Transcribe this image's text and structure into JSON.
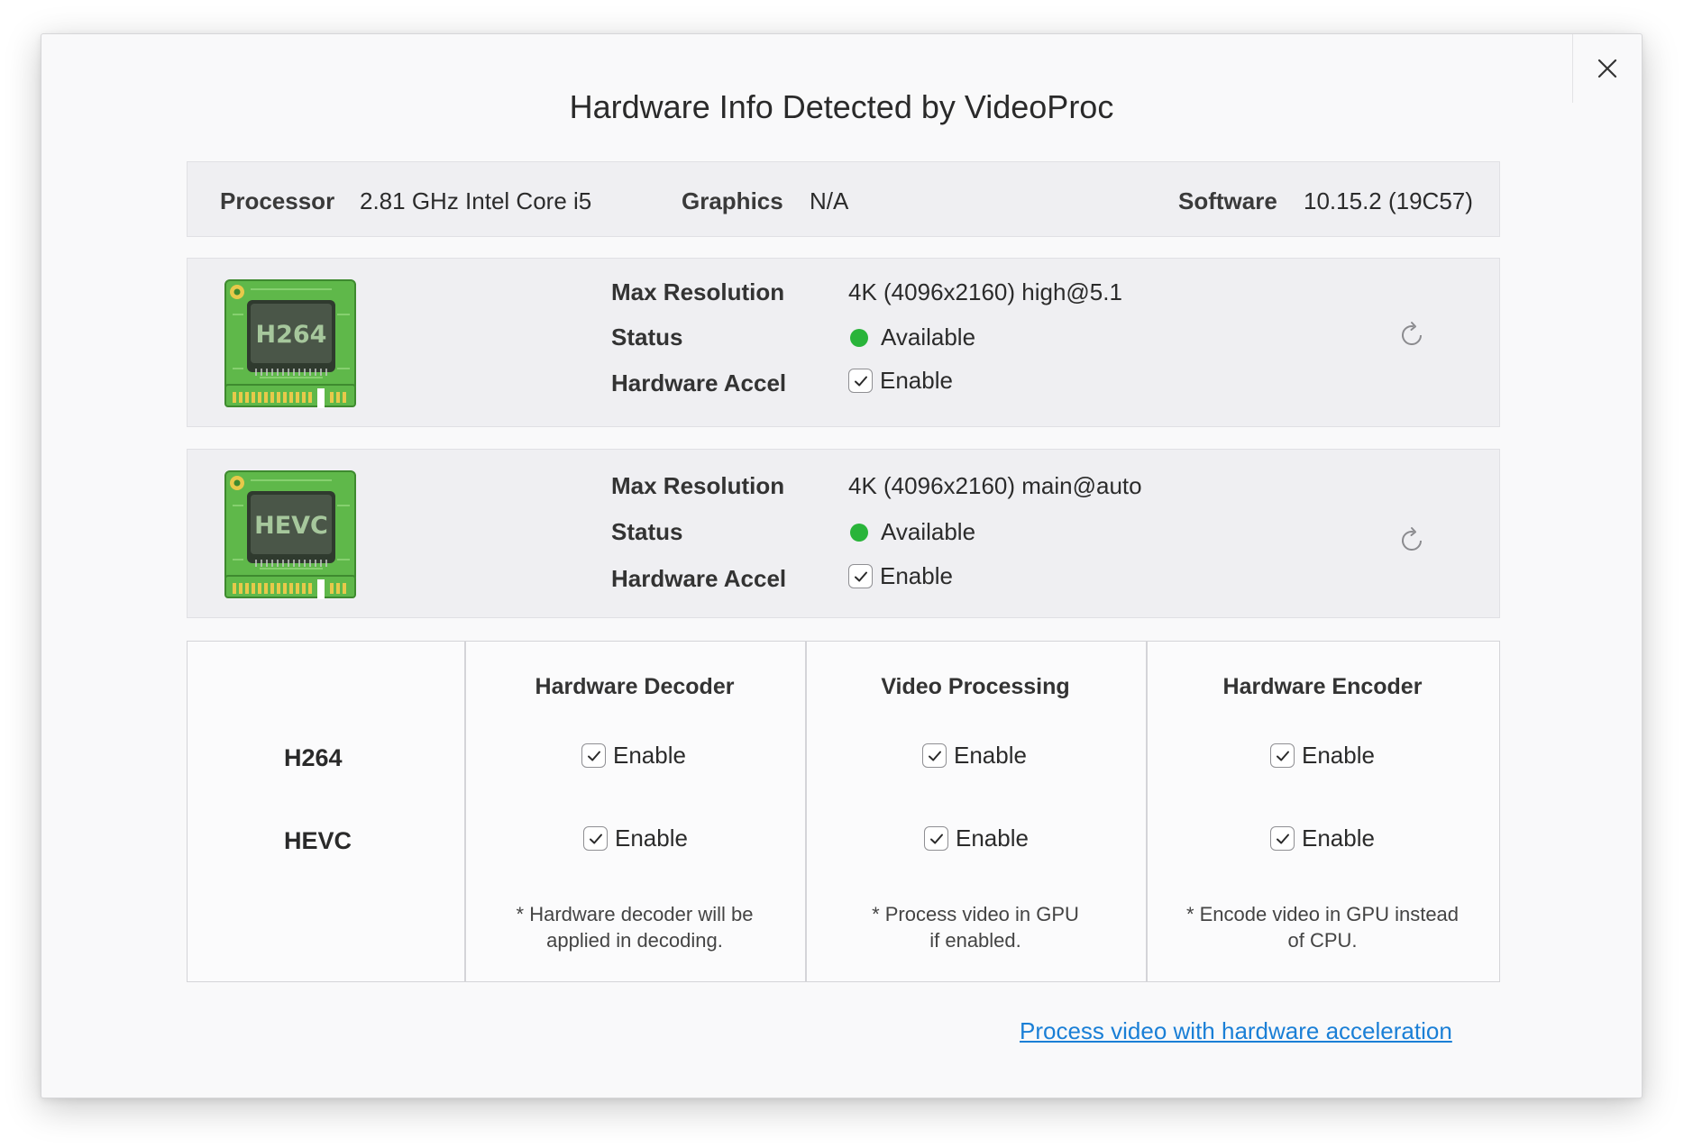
{
  "dialog": {
    "title": "Hardware Info Detected by VideoProc",
    "close_icon": "close-icon"
  },
  "system_info": {
    "processor_label": "Processor",
    "processor_value": "2.81 GHz Intel Core i5",
    "graphics_label": "Graphics",
    "graphics_value": "N/A",
    "software_label": "Software",
    "software_value": "10.15.2 (19C57)"
  },
  "codecs": [
    {
      "chip_label": "H264",
      "max_resolution_label": "Max Resolution",
      "max_resolution_value": "4K (4096x2160) high@5.1",
      "status_label": "Status",
      "status_value": "Available",
      "status_color": "#29b43a",
      "accel_label": "Hardware Accel",
      "accel_checkbox_label": "Enable",
      "accel_checked": true
    },
    {
      "chip_label": "HEVC",
      "max_resolution_label": "Max Resolution",
      "max_resolution_value": "4K (4096x2160) main@auto",
      "status_label": "Status",
      "status_value": "Available",
      "status_color": "#29b43a",
      "accel_label": "Hardware Accel",
      "accel_checkbox_label": "Enable",
      "accel_checked": true
    }
  ],
  "matrix": {
    "columns": [
      "Hardware Decoder",
      "Video Processing",
      "Hardware Encoder"
    ],
    "rows": [
      "H264",
      "HEVC"
    ],
    "checkbox_label": "Enable",
    "notes": [
      [
        "* Hardware decoder will be",
        "applied in decoding."
      ],
      [
        "* Process video in GPU",
        "if enabled."
      ],
      [
        "* Encode video in GPU instead",
        "of CPU."
      ]
    ]
  },
  "footer": {
    "link_text": "Process video with hardware acceleration",
    "link_color": "#1a7fd6"
  }
}
